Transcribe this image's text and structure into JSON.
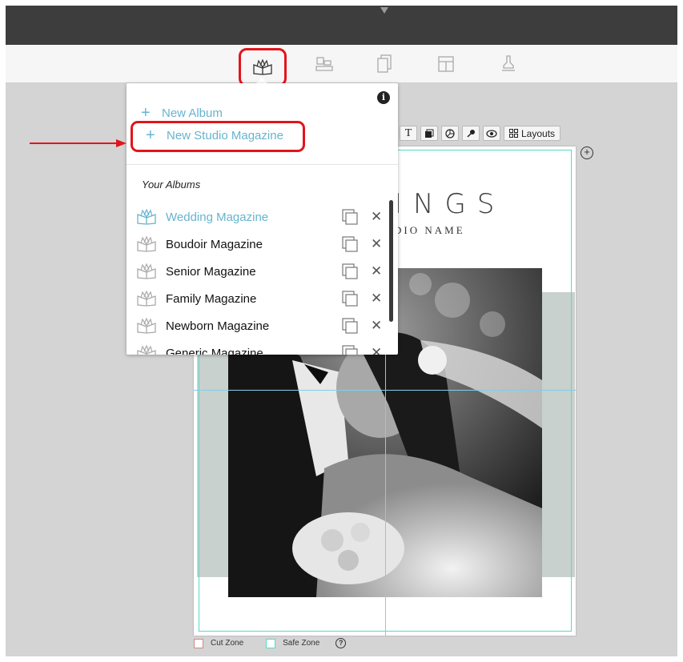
{
  "toolbar": {
    "tools": [
      {
        "name": "albums",
        "icon": "book-open-icon",
        "active": true
      },
      {
        "name": "layouts",
        "icon": "layout-icon",
        "active": false
      },
      {
        "name": "pages",
        "icon": "pages-icon",
        "active": false
      },
      {
        "name": "templates",
        "icon": "template-icon",
        "active": false
      },
      {
        "name": "stamp",
        "icon": "stamp-icon",
        "active": false
      }
    ]
  },
  "popover": {
    "new_album_label": "New Album",
    "new_studio_magazine_label": "New Studio Magazine",
    "section_label": "Your Albums",
    "albums": [
      {
        "name": "Wedding Magazine",
        "active": true
      },
      {
        "name": "Boudoir Magazine",
        "active": false
      },
      {
        "name": "Senior Magazine",
        "active": false
      },
      {
        "name": "Family Magazine",
        "active": false
      },
      {
        "name": "Newborn Magazine",
        "active": false
      },
      {
        "name": "Generic Magazine",
        "active": false
      }
    ]
  },
  "page_toolbar": {
    "text_tool": "T",
    "layouts_label": "Layouts"
  },
  "page": {
    "title": "INGS",
    "subtitle": "DIO NAME"
  },
  "legend": {
    "cut_zone": "Cut Zone",
    "safe_zone": "Safe Zone",
    "help": "?"
  },
  "colors": {
    "accent": "#67b4cf",
    "highlight": "#e3141b",
    "safe_zone": "#58d8c8",
    "topbar": "#3d3d3d"
  }
}
